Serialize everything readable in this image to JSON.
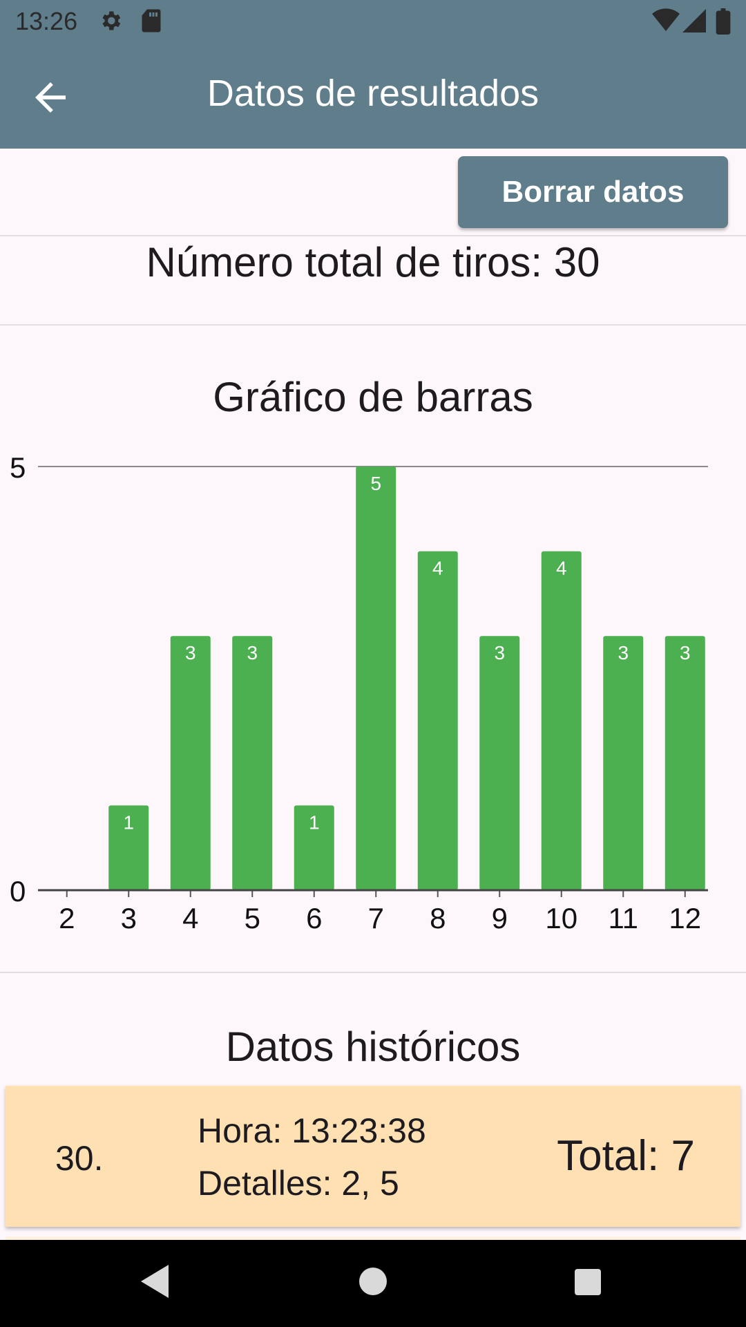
{
  "status_bar": {
    "time": "13:26",
    "icons": [
      "gear-icon",
      "sd-card-icon",
      "wifi-icon",
      "signal-icon",
      "battery-icon"
    ]
  },
  "app_bar": {
    "title": "Datos de resultados",
    "back_icon": "arrow-back-icon"
  },
  "actions": {
    "clear_label": "Borrar datos"
  },
  "summary": {
    "total_label": "Número total de tiros: 30"
  },
  "chart_section": {
    "title": "Gráfico de barras"
  },
  "chart_data": {
    "type": "bar",
    "title": "Gráfico de barras",
    "categories": [
      "2",
      "3",
      "4",
      "5",
      "6",
      "7",
      "8",
      "9",
      "10",
      "11",
      "12"
    ],
    "values": [
      0,
      1,
      3,
      3,
      1,
      5,
      4,
      3,
      4,
      3,
      3
    ],
    "ylim": [
      0,
      5
    ],
    "y_ticks": [
      "0",
      "5"
    ],
    "bar_color": "#4caf50",
    "data_labels": true
  },
  "history": {
    "title": "Datos históricos",
    "entries": [
      {
        "index": "30.",
        "time": "Hora: 13:23:38",
        "details": "Detalles: 2, 5",
        "total": "Total: 7"
      }
    ]
  },
  "colors": {
    "primary": "#607d8b",
    "background": "#fdf7fc",
    "card": "#ffe0b2",
    "bar": "#4caf50"
  },
  "nav_bar": {
    "icons": [
      "back-triangle-icon",
      "home-circle-icon",
      "recents-square-icon"
    ]
  }
}
